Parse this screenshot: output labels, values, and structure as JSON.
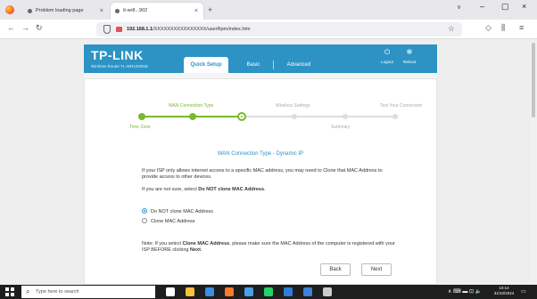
{
  "browser": {
    "tabs": [
      {
        "label": "Problem loading page"
      },
      {
        "label": "tl-wr8...902",
        "active": true
      }
    ],
    "icons": {
      "new_tab": "+",
      "close": "×",
      "tabs_dropdown": "∨",
      "back": "←",
      "forward": "→",
      "reload": "↻",
      "star": "☆",
      "pocket": "◇",
      "library": "⫼",
      "menu": "≡",
      "minimize": "–",
      "maximize": "▢",
      "window_close": "×"
    },
    "url_host": "192.168.1.1",
    "url_rest": "/XXXXXXXXXXXXXXXX/userRpm/index.htm"
  },
  "router": {
    "logo": "TP-LINK",
    "model": "Wireless Router TL-WR1043ND",
    "nav": [
      {
        "label": "Quick Setup",
        "active": true
      },
      {
        "label": "Basic"
      },
      {
        "label": "Advanced"
      }
    ],
    "header_icons": {
      "logout": {
        "icon": "⏻",
        "label": "Logout"
      },
      "reboot": {
        "icon": "✻",
        "label": "Reboot"
      }
    },
    "steps_top": [
      "WAN Connection Type",
      "Wireless Settings",
      "Test Your Connection"
    ],
    "steps_bottom": [
      "Time Zone",
      "Summary"
    ],
    "progress": {
      "completed_steps": 2,
      "total_steps": 6
    },
    "section_title": "WAN Connection Type - Dynamic IP",
    "intro_text": "If your ISP only allows internet access to a specific MAC address, you may need to Clone that MAC Address to provide access to other devices.",
    "hint_prefix": "If you are not sure, select ",
    "hint_bold": "Do NOT clone MAC Address",
    "hint_suffix": ".",
    "radio_options": [
      {
        "label": "Do NOT clone MAC Address",
        "selected": true
      },
      {
        "label": "Clone MAC Address",
        "selected": false
      }
    ],
    "note_prefix": "Note: If you select ",
    "note_bold": "Clone MAC Address",
    "note_middle": ", please make sure the MAC Address of the computer is registered with your ISP BEFORE clicking ",
    "note_bold2": "Next",
    "note_suffix": ".",
    "back_label": "Back",
    "next_label": "Next"
  },
  "taskbar": {
    "search_placeholder": "Type here to search",
    "search_icon": "⌕",
    "app_icons": [
      {
        "name": "task-view-icon",
        "color": "#ffffff"
      },
      {
        "name": "file-explorer-icon",
        "color": "#f6c23e"
      },
      {
        "name": "edge-icon",
        "color": "#3a8ee6"
      },
      {
        "name": "firefox-icon",
        "color": "#ff7a2a"
      },
      {
        "name": "store-icon",
        "color": "#4a9ee8"
      },
      {
        "name": "whatsapp-icon",
        "color": "#25d366"
      },
      {
        "name": "photos-icon",
        "color": "#2f7bd8"
      },
      {
        "name": "mail-icon",
        "color": "#3d82d8"
      },
      {
        "name": "settings-icon",
        "color": "#cccccc"
      }
    ],
    "tray_icons": "∧  ⌨  ▬  ⊡  🔈",
    "time": "10:14",
    "date": "31/10/2024",
    "notification_icon": "▭"
  }
}
